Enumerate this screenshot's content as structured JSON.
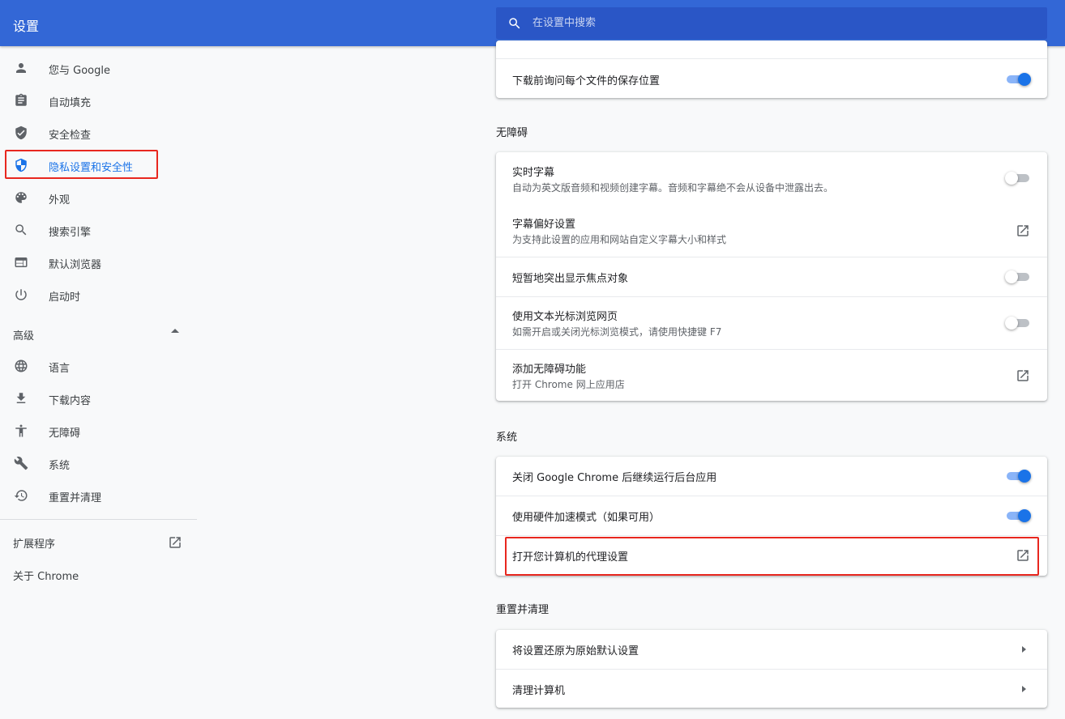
{
  "header": {
    "title": "设置",
    "search_placeholder": "在设置中搜索"
  },
  "sidebar": {
    "items": [
      {
        "label": "您与 Google",
        "icon": "person-icon"
      },
      {
        "label": "自动填充",
        "icon": "clipboard-icon"
      },
      {
        "label": "安全检查",
        "icon": "shield-check-icon"
      },
      {
        "label": "隐私设置和安全性",
        "icon": "privacy-shield-icon",
        "active": true
      },
      {
        "label": "外观",
        "icon": "palette-icon"
      },
      {
        "label": "搜索引擎",
        "icon": "search-icon"
      },
      {
        "label": "默认浏览器",
        "icon": "browser-icon"
      },
      {
        "label": "启动时",
        "icon": "power-icon"
      }
    ],
    "advanced_label": "高级",
    "advanced_items": [
      {
        "label": "语言",
        "icon": "globe-icon"
      },
      {
        "label": "下载内容",
        "icon": "download-icon"
      },
      {
        "label": "无障碍",
        "icon": "accessibility-icon"
      },
      {
        "label": "系统",
        "icon": "wrench-icon"
      },
      {
        "label": "重置并清理",
        "icon": "restore-icon"
      }
    ],
    "extensions_label": "扩展程序",
    "about_label": "关于 Chrome"
  },
  "downloads_card": {
    "ask_location": "下载前询问每个文件的保存位置",
    "ask_location_on": true
  },
  "accessibility": {
    "section_title": "无障碍",
    "live_caption_title": "实时字幕",
    "live_caption_sub": "自动为英文版音频和视频创建字幕。音频和字幕绝不会从设备中泄露出去。",
    "live_caption_on": false,
    "caption_pref_title": "字幕偏好设置",
    "caption_pref_sub": "为支持此设置的应用和网站自定义字幕大小和样式",
    "focus_highlight_title": "短暂地突出显示焦点对象",
    "focus_highlight_on": false,
    "caret_browsing_title": "使用文本光标浏览网页",
    "caret_browsing_sub": "如需开启或关闭光标浏览模式，请使用快捷键 F7",
    "caret_browsing_on": false,
    "add_features_title": "添加无障碍功能",
    "add_features_sub": "打开 Chrome 网上应用店"
  },
  "system": {
    "section_title": "系统",
    "background_apps_title": "关闭 Google Chrome 后继续运行后台应用",
    "background_apps_on": true,
    "hardware_accel_title": "使用硬件加速模式（如果可用）",
    "hardware_accel_on": true,
    "proxy_title": "打开您计算机的代理设置"
  },
  "reset": {
    "section_title": "重置并清理",
    "restore_title": "将设置还原为原始默认设置",
    "cleanup_title": "清理计算机"
  },
  "colors": {
    "header_bg": "#3367d6",
    "accent": "#1a73e8",
    "highlight_border": "#e8271f"
  }
}
